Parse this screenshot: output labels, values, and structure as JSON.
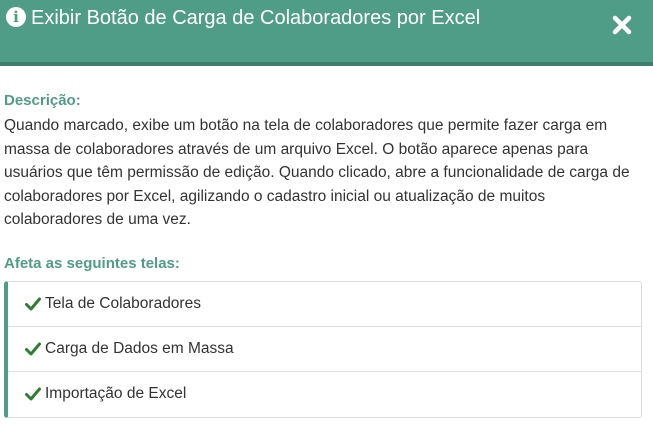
{
  "header": {
    "title": "Exibir Botão de Carga de Colaboradores por Excel",
    "info_icon": "info-circle-icon",
    "close_icon": "close-icon",
    "bg_color": "#4f9d87"
  },
  "description": {
    "heading": "Descrição:",
    "text": "Quando marcado, exibe um botão na tela de colaboradores que permite fazer carga em massa de colaboradores através de um arquivo Excel. O botão aparece apenas para usuários que têm permissão de edição. Quando clicado, abre a funcionalidade de carga de colaboradores por Excel, agilizando o cadastro inicial ou atualização de muitos colaboradores de uma vez."
  },
  "affected": {
    "heading": "Afeta as seguintes telas:",
    "check_icon": "check-icon",
    "check_color": "#2e7d32",
    "items": [
      {
        "label": "Tela de Colaboradores"
      },
      {
        "label": "Carga de Dados em Massa"
      },
      {
        "label": "Importação de Excel"
      }
    ]
  }
}
